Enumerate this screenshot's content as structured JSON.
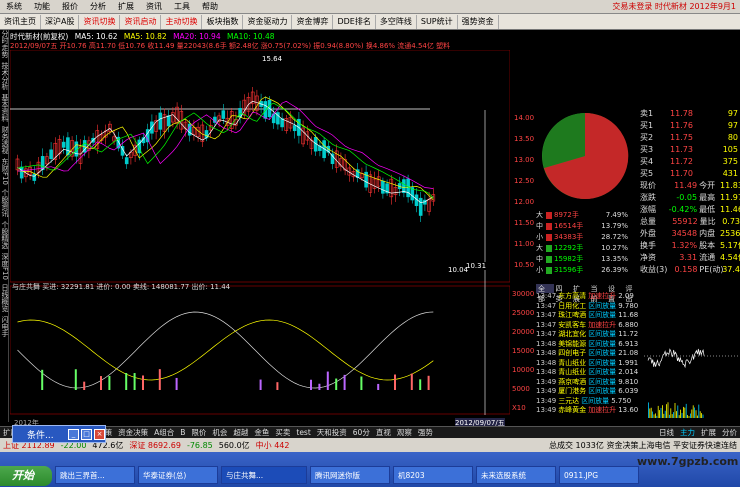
{
  "menu": [
    "系统",
    "功能",
    "报价",
    "分析",
    "扩展",
    "资讯",
    "工具",
    "帮助"
  ],
  "menu_right": "交易未登录 时代新材 2012年9月1",
  "toolbar": [
    {
      "label": "资讯主页",
      "red": false
    },
    {
      "label": "深沪A股",
      "red": false
    },
    {
      "label": "资讯切换",
      "red": true
    },
    {
      "label": "资讯启动",
      "red": true
    },
    {
      "label": "主动切换",
      "red": true
    },
    {
      "label": "板块指数",
      "red": false
    },
    {
      "label": "资金驱动力",
      "red": false
    },
    {
      "label": "资金博弈",
      "red": false
    },
    {
      "label": "DDE排名",
      "red": false
    },
    {
      "label": "多空阵线",
      "red": false
    },
    {
      "label": "SUP统计",
      "red": false
    },
    {
      "label": "强势资金",
      "red": false
    }
  ],
  "leftbar": [
    "分时走势",
    "技术分析",
    "基本资料",
    "财务透视",
    "东财F10",
    "个股资讯",
    "个股精选",
    "深度F10",
    "日线概览",
    "闪电手"
  ],
  "chart_info": {
    "line1_name": "时代新材(前复权)",
    "ma5": "MA5: 10.62",
    "ma10": "MA5: 10.82",
    "ma20": "MA20: 10.94",
    "ma30": "MA10: 10.48",
    "line2": "2012/09/07五 开10.76 高11.70 低10.76 收11.49 量22043(8.6手 额2.48亿 涨0.75(7.02%) 振0.94(8.80%) 换4.86% 流通4.54亿 塑料",
    "price_max": "15.64",
    "price_min": "10.04",
    "price_end": "10.31",
    "sub_line": "与庄共舞  买进: 32291.81  进价: 0.00  卖线: 148081.77  出价: 11.44",
    "axis_labels": [
      "14.00",
      "13.50",
      "13.00",
      "12.50",
      "12.00",
      "11.50",
      "11.00",
      "10.50"
    ],
    "sub_axis": [
      "30000",
      "25000",
      "20000",
      "15000",
      "10000",
      "5000",
      "X10"
    ],
    "date_label": "2012/09/07/五",
    "left_date": "2012年"
  },
  "chart_data": {
    "type": "candlestick",
    "ylim": [
      10.0,
      16.0
    ],
    "sub_ylim": [
      0,
      32000
    ],
    "price_labels": [
      "15.64",
      "10.04",
      "10.31"
    ]
  },
  "quote": {
    "sells": [
      {
        "label": "卖1",
        "price": "11.78",
        "vol": "97"
      },
      {
        "label": "买1",
        "price": "11.76",
        "vol": "97"
      },
      {
        "label": "买2",
        "price": "11.75",
        "vol": "80"
      },
      {
        "label": "买3",
        "price": "11.73",
        "vol": "105"
      },
      {
        "label": "买4",
        "price": "11.72",
        "vol": "375"
      },
      {
        "label": "买5",
        "price": "11.70",
        "vol": "431"
      }
    ],
    "stats": [
      {
        "k1": "现价",
        "v1": "11.49",
        "k2": "今开",
        "v2": "11.83"
      },
      {
        "k1": "涨跌",
        "v1": "-0.05",
        "k2": "最高",
        "v2": "11.97"
      },
      {
        "k1": "涨幅",
        "v1": "-0.42%",
        "k2": "最低",
        "v2": "11.46"
      },
      {
        "k1": "总量",
        "v1": "55912",
        "k2": "量比",
        "v2": "0.73"
      },
      {
        "k1": "外盘",
        "v1": "34548",
        "k2": "内盘",
        "v2": "25364"
      },
      {
        "k1": "换手",
        "v1": "1.32%",
        "k2": "股本",
        "v2": "5.17亿"
      },
      {
        "k1": "净资",
        "v1": "3.31",
        "k2": "流通",
        "v2": "4.54亿"
      },
      {
        "k1": "收益(3)",
        "v1": "0.158",
        "k2": "PE(动)",
        "v2": "37.4"
      }
    ],
    "orderflow": [
      {
        "side": "大",
        "val": "8972手",
        "pct": "7.49%"
      },
      {
        "side": "中",
        "val": "16514手",
        "pct": "13.79%"
      },
      {
        "side": "小",
        "val": "34383手",
        "pct": "28.72%"
      },
      {
        "side": "大",
        "val": "12292手",
        "pct": "10.27%"
      },
      {
        "side": "中",
        "val": "15982手",
        "pct": "13.35%"
      },
      {
        "side": "小",
        "val": "31596手",
        "pct": "26.39%"
      }
    ],
    "tabs": [
      "全部",
      "四类",
      "扩展",
      "当前",
      "设置",
      "评出"
    ]
  },
  "ticker": [
    {
      "time": "13:47",
      "name": "东方高清",
      "act": "加速拉升",
      "val": "2.09"
    },
    {
      "time": "13:47",
      "name": "日用化工",
      "act": "区间放量",
      "val": "9.780"
    },
    {
      "time": "13:47",
      "name": "珠江啤酒",
      "act": "区间放量",
      "val": "11.68"
    },
    {
      "time": "13:47",
      "name": "安凯客车",
      "act": "加速拉升",
      "val": "6.880"
    },
    {
      "time": "13:47",
      "name": "湖北宜化",
      "act": "区间放量",
      "val": "11.72"
    },
    {
      "time": "13:48",
      "name": "美锦能源",
      "act": "区间放量",
      "val": "6.913"
    },
    {
      "time": "13:48",
      "name": "四创电子",
      "act": "区间放量",
      "val": "21.08"
    },
    {
      "time": "13:48",
      "name": "青山纸业",
      "act": "区间放量",
      "val": "1.991"
    },
    {
      "time": "13:48",
      "name": "青山纸业",
      "act": "区间放量",
      "val": "2.014"
    },
    {
      "time": "13:49",
      "name": "燕京啤酒",
      "act": "区间放量",
      "val": "9.810"
    },
    {
      "time": "13:49",
      "name": "厦门港务",
      "act": "区间放量",
      "val": "6.039"
    },
    {
      "time": "13:49",
      "name": "三元达",
      "act": "区间放量",
      "val": "5.750"
    },
    {
      "time": "13:49",
      "name": "赤峰黄金",
      "act": "加速拉升",
      "val": "13.60"
    }
  ],
  "bottomtabs": [
    "扩展",
    "基本",
    "DDE决策",
    "SUP决策",
    "资金决策",
    "A组合",
    "B",
    "限价",
    "机会",
    "超越",
    "金鱼",
    "买卖",
    "test",
    "天和投资",
    "60分",
    "直视",
    "观察",
    "强势"
  ],
  "bottomtabs_right": [
    "日线",
    "主力",
    "扩展",
    "分价"
  ],
  "status": {
    "shanghai": "上证 2112.89",
    "sh_chg": "-22.00",
    "sh_amt": "472.6亿",
    "shenzhen": "深证 8692.69",
    "sz_chg": "-76.85",
    "sz_amt": "560.0亿",
    "zx": "中小 442",
    "news": "总成交 1033亿  资金决策上海电信  平安证券快速连结"
  },
  "popup": {
    "title": "条件..."
  },
  "taskbar": {
    "start": "开始",
    "tasks": [
      "跳出三界首...",
      "华泰证券(总)",
      "与庄共舞...",
      "腾讯网迷你版",
      "机8203",
      "未来选股系统",
      "0911.JPG"
    ]
  },
  "watermark": "www.7gpzb.com"
}
